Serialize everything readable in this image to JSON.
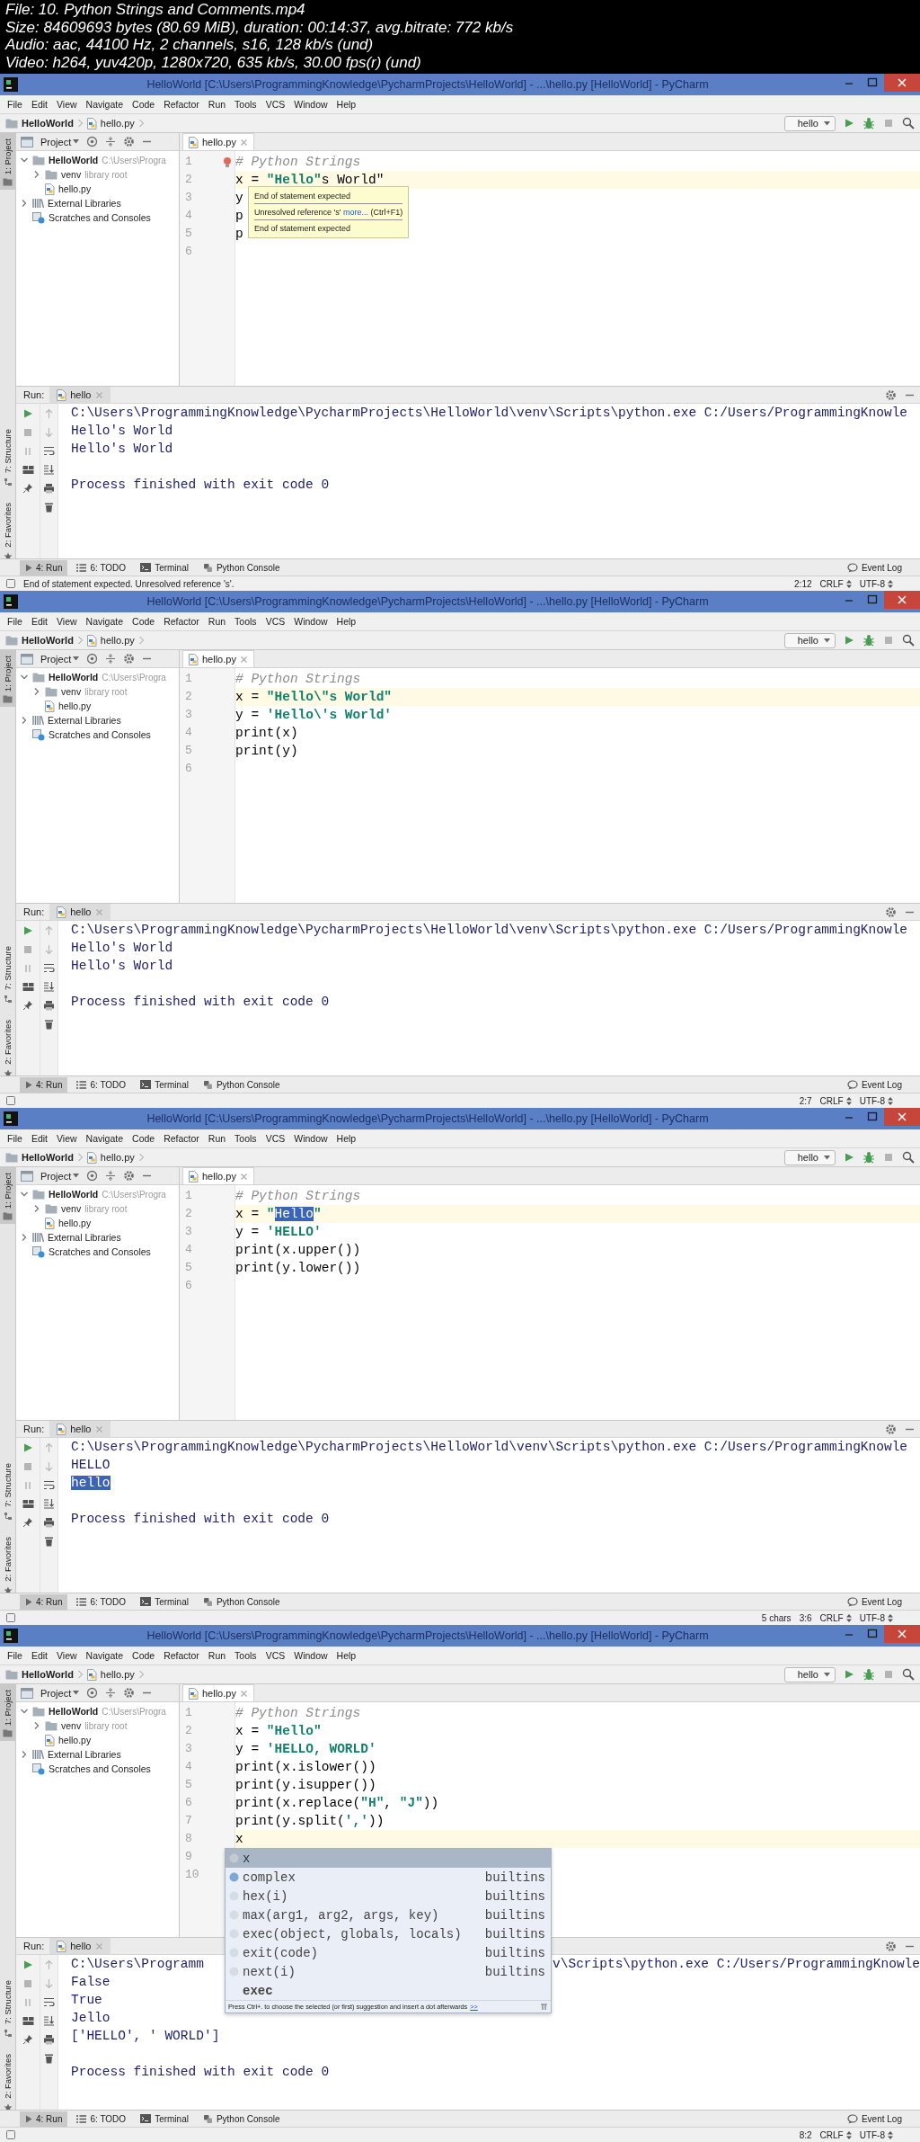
{
  "video_info": {
    "lines": [
      "File: 10. Python Strings and Comments.mp4",
      "Size: 84609693 bytes (80.69 MiB), duration: 00:14:37, avg.bitrate: 772 kb/s",
      "Audio: aac, 44100 Hz, 2 channels, s16, 128 kb/s (und)",
      "Video: h264, yuv420p, 1280x720, 635 kb/s, 30.00 fps(r) (und)"
    ]
  },
  "panels": [
    {
      "title": "HelloWorld [C:\\Users\\ProgrammingKnowledge\\PycharmProjects\\HelloWorld] - ...\\hello.py [HelloWorld] - PyCharm",
      "menu": [
        "File",
        "Edit",
        "View",
        "Navigate",
        "Code",
        "Refactor",
        "Run",
        "Tools",
        "VCS",
        "Window",
        "Help"
      ],
      "breadcrumbs": [
        "HelloWorld",
        "hello.py"
      ],
      "run_config": "hello",
      "project_tab": "1: Project",
      "project_panel": {
        "title": "Project",
        "tree": [
          {
            "label": "HelloWorld",
            "hint": "C:\\Users\\Progra",
            "kind": "project",
            "expanded": true,
            "children": [
              {
                "label": "venv",
                "hint": "library root",
                "kind": "folder",
                "expanded": false
              },
              {
                "label": "hello.py",
                "kind": "file"
              }
            ]
          },
          {
            "label": "External Libraries",
            "kind": "libraries",
            "expanded": false
          },
          {
            "label": "Scratches and Consoles",
            "kind": "scratches"
          }
        ]
      },
      "editor_tab": "hello.py",
      "code_lines": [
        {
          "number": "1",
          "current": false,
          "bulb": true,
          "tokens": [
            {
              "kind": "comment",
              "text": "# Python Strings"
            }
          ]
        },
        {
          "number": "2",
          "current": true,
          "tokens": [
            {
              "kind": "plain",
              "text": "x = "
            },
            {
              "kind": "string",
              "text": "\"Hello\""
            },
            {
              "kind": "error",
              "text": "s World\""
            }
          ],
          "tooltip": {
            "messages": [
              {
                "text": "End of statement expected"
              },
              {
                "text": "Unresolved reference 's'",
                "link": "more...",
                "shortcut": "(Ctrl+F1)"
              },
              {
                "text": "End of statement expected"
              }
            ]
          }
        },
        {
          "number": "3",
          "current": false,
          "tokens": [
            {
              "kind": "plain",
              "text": "y"
            }
          ]
        },
        {
          "number": "4",
          "current": false,
          "tokens": [
            {
              "kind": "plain",
              "text": "p"
            }
          ]
        },
        {
          "number": "5",
          "current": false,
          "tokens": [
            {
              "kind": "plain",
              "text": "p"
            }
          ]
        },
        {
          "number": "6",
          "current": false
        }
      ],
      "run": {
        "label": "Run:",
        "tab": "hello",
        "output": [
          {
            "kind": "plain",
            "text": "C:\\Users\\ProgrammingKnowledge\\PycharmProjects\\HelloWorld\\venv\\Scripts\\python.exe C:/Users/ProgrammingKnowle"
          },
          {
            "kind": "plain",
            "text": "Hello's World"
          },
          {
            "kind": "plain",
            "text": "Hello's World"
          },
          {
            "kind": "blank"
          },
          {
            "kind": "plain",
            "text": "Process finished with exit code 0"
          }
        ]
      },
      "side_tabs": [
        {
          "label": "7: Structure",
          "kind": "structure"
        },
        {
          "label": "2: Favorites",
          "kind": "favorites"
        }
      ],
      "tool_tabs": [
        {
          "label": "4: Run",
          "kind": "run",
          "selected": true
        },
        {
          "label": "6: TODO",
          "kind": "todo",
          "selected": false
        },
        {
          "label": "Terminal",
          "kind": "terminal",
          "selected": false
        },
        {
          "label": "Python Console",
          "kind": "console",
          "selected": false
        }
      ],
      "event_log": "Event Log",
      "status": {
        "message": "End of statement expected. Unresolved reference 's'.",
        "items": [
          {
            "text": "2:12",
            "kind": "plain"
          },
          {
            "text": "CRLF",
            "kind": "dropdown"
          },
          {
            "text": "UTF-8",
            "kind": "dropdown"
          }
        ]
      }
    },
    {
      "title": "HelloWorld [C:\\Users\\ProgrammingKnowledge\\PycharmProjects\\HelloWorld] - ...\\hello.py [HelloWorld] - PyCharm",
      "menu": [
        "File",
        "Edit",
        "View",
        "Navigate",
        "Code",
        "Refactor",
        "Run",
        "Tools",
        "VCS",
        "Window",
        "Help"
      ],
      "breadcrumbs": [
        "HelloWorld",
        "hello.py"
      ],
      "run_config": "hello",
      "project_tab": "1: Project",
      "project_panel": {
        "title": "Project",
        "tree": [
          {
            "label": "HelloWorld",
            "hint": "C:\\Users\\Progra",
            "kind": "project",
            "expanded": true,
            "children": [
              {
                "label": "venv",
                "hint": "library root",
                "kind": "folder",
                "expanded": false
              },
              {
                "label": "hello.py",
                "kind": "file"
              }
            ]
          },
          {
            "label": "External Libraries",
            "kind": "libraries",
            "expanded": false
          },
          {
            "label": "Scratches and Consoles",
            "kind": "scratches"
          }
        ]
      },
      "editor_tab": "hello.py",
      "code_lines": [
        {
          "number": "1",
          "current": false,
          "tokens": [
            {
              "kind": "comment",
              "text": "# Python Strings"
            }
          ]
        },
        {
          "number": "2",
          "current": true,
          "tokens": [
            {
              "kind": "plain",
              "text": "x = "
            },
            {
              "kind": "string",
              "text": "\"Hello\\\"s World\""
            }
          ]
        },
        {
          "number": "3",
          "current": false,
          "tokens": [
            {
              "kind": "plain",
              "text": "y = "
            },
            {
              "kind": "string",
              "text": "'Hello\\'s World'"
            }
          ]
        },
        {
          "number": "4",
          "current": false,
          "tokens": [
            {
              "kind": "plain",
              "text": "print(x)"
            }
          ]
        },
        {
          "number": "5",
          "current": false,
          "tokens": [
            {
              "kind": "plain",
              "text": "print(y)"
            }
          ]
        },
        {
          "number": "6",
          "current": false
        }
      ],
      "run": {
        "label": "Run:",
        "tab": "hello",
        "output": [
          {
            "kind": "plain",
            "text": "C:\\Users\\ProgrammingKnowledge\\PycharmProjects\\HelloWorld\\venv\\Scripts\\python.exe C:/Users/ProgrammingKnowle"
          },
          {
            "kind": "plain",
            "text": "Hello's World"
          },
          {
            "kind": "plain",
            "text": "Hello's World"
          },
          {
            "kind": "blank"
          },
          {
            "kind": "plain",
            "text": "Process finished with exit code 0"
          }
        ]
      },
      "side_tabs": [
        {
          "label": "7: Structure",
          "kind": "structure"
        },
        {
          "label": "2: Favorites",
          "kind": "favorites"
        }
      ],
      "tool_tabs": [
        {
          "label": "4: Run",
          "kind": "run",
          "selected": true
        },
        {
          "label": "6: TODO",
          "kind": "todo",
          "selected": false
        },
        {
          "label": "Terminal",
          "kind": "terminal",
          "selected": false
        },
        {
          "label": "Python Console",
          "kind": "console",
          "selected": false
        }
      ],
      "event_log": "Event Log",
      "status": {
        "items": [
          {
            "text": "2:7",
            "kind": "plain"
          },
          {
            "text": "CRLF",
            "kind": "dropdown"
          },
          {
            "text": "UTF-8",
            "kind": "dropdown"
          }
        ]
      }
    },
    {
      "title": "HelloWorld [C:\\Users\\ProgrammingKnowledge\\PycharmProjects\\HelloWorld] - ...\\hello.py [HelloWorld] - PyCharm",
      "menu": [
        "File",
        "Edit",
        "View",
        "Navigate",
        "Code",
        "Refactor",
        "Run",
        "Tools",
        "VCS",
        "Window",
        "Help"
      ],
      "breadcrumbs": [
        "HelloWorld",
        "hello.py"
      ],
      "run_config": "hello",
      "project_tab": "1: Project",
      "project_panel": {
        "title": "Project",
        "tree": [
          {
            "label": "HelloWorld",
            "hint": "C:\\Users\\Progra",
            "kind": "project",
            "expanded": true,
            "children": [
              {
                "label": "venv",
                "hint": "library root",
                "kind": "folder",
                "expanded": false
              },
              {
                "label": "hello.py",
                "kind": "file"
              }
            ]
          },
          {
            "label": "External Libraries",
            "kind": "libraries",
            "expanded": false
          },
          {
            "label": "Scratches and Consoles",
            "kind": "scratches"
          }
        ]
      },
      "editor_tab": "hello.py",
      "code_lines": [
        {
          "number": "1",
          "current": false,
          "tokens": [
            {
              "kind": "comment",
              "text": "# Python Strings"
            }
          ]
        },
        {
          "number": "2",
          "current": true,
          "tokens": [
            {
              "kind": "plain",
              "text": "x = "
            },
            {
              "kind": "string",
              "text": "\""
            },
            {
              "kind": "selection",
              "text": "Hello"
            },
            {
              "kind": "string",
              "text": "\""
            }
          ]
        },
        {
          "number": "3",
          "current": false,
          "tokens": [
            {
              "kind": "plain",
              "text": "y = "
            },
            {
              "kind": "string",
              "text": "'HELLO'"
            }
          ]
        },
        {
          "number": "4",
          "current": false,
          "tokens": [
            {
              "kind": "plain",
              "text": "print(x.upper())"
            }
          ]
        },
        {
          "number": "5",
          "current": false,
          "tokens": [
            {
              "kind": "plain",
              "text": "print(y.lower())"
            }
          ]
        },
        {
          "number": "6",
          "current": false
        }
      ],
      "run": {
        "label": "Run:",
        "tab": "hello",
        "output": [
          {
            "kind": "plain",
            "text": "C:\\Users\\ProgrammingKnowledge\\PycharmProjects\\HelloWorld\\venv\\Scripts\\python.exe C:/Users/ProgrammingKnowle"
          },
          {
            "kind": "plain",
            "text": "HELLO"
          },
          {
            "kind": "selection",
            "text": "hello"
          },
          {
            "kind": "blank"
          },
          {
            "kind": "plain",
            "text": "Process finished with exit code 0"
          }
        ]
      },
      "side_tabs": [
        {
          "label": "7: Structure",
          "kind": "structure"
        },
        {
          "label": "2: Favorites",
          "kind": "favorites"
        }
      ],
      "tool_tabs": [
        {
          "label": "4: Run",
          "kind": "run",
          "selected": true
        },
        {
          "label": "6: TODO",
          "kind": "todo",
          "selected": false
        },
        {
          "label": "Terminal",
          "kind": "terminal",
          "selected": false
        },
        {
          "label": "Python Console",
          "kind": "console",
          "selected": false
        }
      ],
      "event_log": "Event Log",
      "status": {
        "items": [
          {
            "text": "5 chars",
            "kind": "plain"
          },
          {
            "text": "3:6",
            "kind": "plain"
          },
          {
            "text": "CRLF",
            "kind": "dropdown"
          },
          {
            "text": "UTF-8",
            "kind": "dropdown"
          }
        ]
      }
    },
    {
      "title": "HelloWorld [C:\\Users\\ProgrammingKnowledge\\PycharmProjects\\HelloWorld] - ...\\hello.py [HelloWorld] - PyCharm",
      "menu": [
        "File",
        "Edit",
        "View",
        "Navigate",
        "Code",
        "Refactor",
        "Run",
        "Tools",
        "VCS",
        "Window",
        "Help"
      ],
      "breadcrumbs": [
        "HelloWorld",
        "hello.py"
      ],
      "run_config": "hello",
      "project_tab": "1: Project",
      "project_panel": {
        "title": "Project",
        "tree": [
          {
            "label": "HelloWorld",
            "hint": "C:\\Users\\Progra",
            "kind": "project",
            "expanded": true,
            "children": [
              {
                "label": "venv",
                "hint": "library root",
                "kind": "folder",
                "expanded": false
              },
              {
                "label": "hello.py",
                "kind": "file"
              }
            ]
          },
          {
            "label": "External Libraries",
            "kind": "libraries",
            "expanded": false
          },
          {
            "label": "Scratches and Consoles",
            "kind": "scratches"
          }
        ]
      },
      "editor_tab": "hello.py",
      "code_lines": [
        {
          "number": "1",
          "current": false,
          "tokens": [
            {
              "kind": "comment",
              "text": "# Python Strings"
            }
          ]
        },
        {
          "number": "2",
          "current": false,
          "tokens": [
            {
              "kind": "plain",
              "text": "x = "
            },
            {
              "kind": "string",
              "text": "\"Hello\""
            }
          ]
        },
        {
          "number": "3",
          "current": false,
          "tokens": [
            {
              "kind": "plain",
              "text": "y = "
            },
            {
              "kind": "string",
              "text": "'HELLO, WORLD'"
            }
          ]
        },
        {
          "number": "4",
          "current": false,
          "tokens": [
            {
              "kind": "plain",
              "text": "print(x.islower())"
            }
          ]
        },
        {
          "number": "5",
          "current": false,
          "tokens": [
            {
              "kind": "plain",
              "text": "print(y.isupper())"
            }
          ]
        },
        {
          "number": "6",
          "current": false,
          "tokens": [
            {
              "kind": "plain",
              "text": "print(x.replace("
            },
            {
              "kind": "string",
              "text": "\"H\""
            },
            {
              "kind": "plain",
              "text": ", "
            },
            {
              "kind": "string",
              "text": "\"J\""
            },
            {
              "kind": "plain",
              "text": "))"
            }
          ]
        },
        {
          "number": "7",
          "current": false,
          "tokens": [
            {
              "kind": "plain",
              "text": "print(y.split("
            },
            {
              "kind": "string",
              "text": "','"
            },
            {
              "kind": "plain",
              "text": "))"
            }
          ]
        },
        {
          "number": "8",
          "current": true,
          "tokens": [
            {
              "kind": "plain",
              "text": "x"
            }
          ],
          "completion": {
            "items": [
              {
                "label": "x",
                "kind": "variable",
                "selected": true
              },
              {
                "label": "complex",
                "type": "builtins",
                "kind": "class",
                "selected": false
              },
              {
                "label": "hex(i)",
                "type": "builtins",
                "kind": "function",
                "selected": false
              },
              {
                "label": "max(arg1, arg2, args, key)",
                "type": "builtins",
                "kind": "function",
                "selected": false
              },
              {
                "label": "exec(object, globals, locals)",
                "type": "builtins",
                "kind": "function",
                "selected": false
              },
              {
                "label": "exit(code)",
                "type": "builtins",
                "kind": "function",
                "selected": false
              },
              {
                "label": "next(i)",
                "type": "builtins",
                "kind": "function",
                "selected": false
              },
              {
                "label": "exec",
                "kind": "keyword",
                "selected": false
              }
            ],
            "hint": "Press Ctrl+. to choose the selected (or first) suggestion and insert a dot afterwards",
            "link": ">>"
          }
        },
        {
          "number": "9",
          "current": false
        },
        {
          "number": "10",
          "current": false
        }
      ],
      "run": {
        "label": "Run:",
        "tab": "hello",
        "output": [
          {
            "kind": "split",
            "text": "C:\\Users\\Programm",
            "text_right": "v\\Scripts\\python.exe C:/Users/ProgrammingKnowle"
          },
          {
            "kind": "plain",
            "text": "False"
          },
          {
            "kind": "plain",
            "text": "True"
          },
          {
            "kind": "plain",
            "text": "Jello"
          },
          {
            "kind": "plain",
            "text": "['HELLO', ' WORLD']"
          },
          {
            "kind": "blank"
          },
          {
            "kind": "plain",
            "text": "Process finished with exit code 0"
          }
        ]
      },
      "side_tabs": [
        {
          "label": "7: Structure",
          "kind": "structure"
        },
        {
          "label": "2: Favorites",
          "kind": "favorites"
        }
      ],
      "tool_tabs": [
        {
          "label": "4: Run",
          "kind": "run",
          "selected": true
        },
        {
          "label": "6: TODO",
          "kind": "todo",
          "selected": false
        },
        {
          "label": "Terminal",
          "kind": "terminal",
          "selected": false
        },
        {
          "label": "Python Console",
          "kind": "console",
          "selected": false
        }
      ],
      "event_log": "Event Log",
      "status": {
        "items": [
          {
            "text": "8:2",
            "kind": "plain"
          },
          {
            "text": "CRLF",
            "kind": "dropdown"
          },
          {
            "text": "UTF-8",
            "kind": "dropdown"
          }
        ]
      }
    }
  ]
}
